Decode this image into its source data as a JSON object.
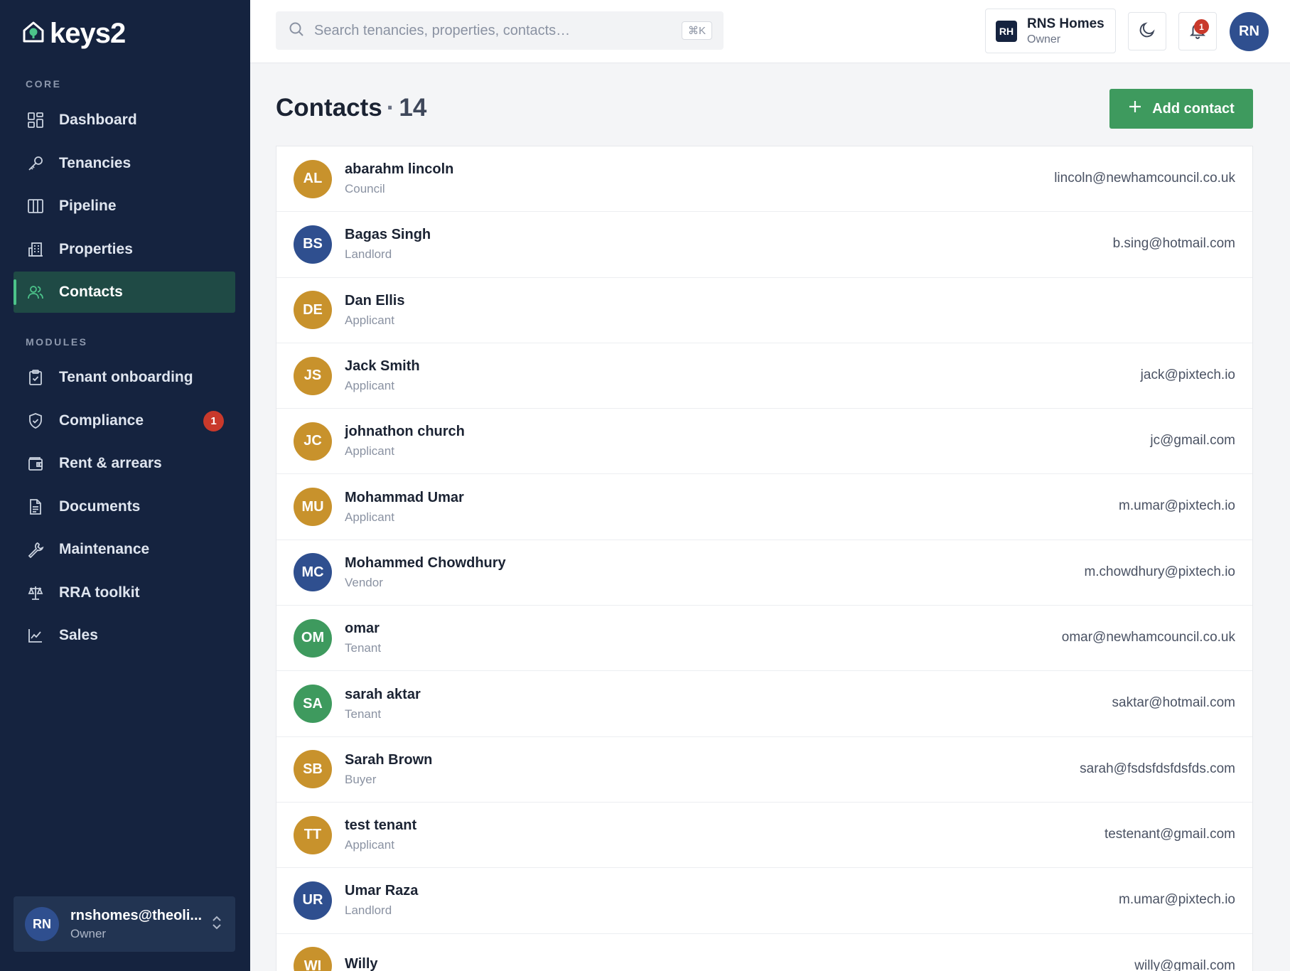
{
  "brand": {
    "name": "keys2"
  },
  "sidebar": {
    "core_label": "CORE",
    "modules_label": "MODULES",
    "core_items": [
      {
        "label": "Dashboard",
        "icon": "dashboard-icon"
      },
      {
        "label": "Tenancies",
        "icon": "key-icon"
      },
      {
        "label": "Pipeline",
        "icon": "columns-icon"
      },
      {
        "label": "Properties",
        "icon": "building-icon"
      },
      {
        "label": "Contacts",
        "icon": "users-icon",
        "active": true
      }
    ],
    "module_items": [
      {
        "label": "Tenant onboarding",
        "icon": "clipboard-check-icon"
      },
      {
        "label": "Compliance",
        "icon": "shield-icon",
        "badge": "1"
      },
      {
        "label": "Rent & arrears",
        "icon": "wallet-icon"
      },
      {
        "label": "Documents",
        "icon": "document-icon"
      },
      {
        "label": "Maintenance",
        "icon": "wrench-icon"
      },
      {
        "label": "RRA toolkit",
        "icon": "scales-icon"
      },
      {
        "label": "Sales",
        "icon": "chart-line-icon"
      }
    ],
    "user": {
      "initials": "RN",
      "email": "rnshomes@theoli...",
      "role": "Owner"
    }
  },
  "topbar": {
    "search_placeholder": "Search tenancies, properties, contacts…",
    "search_shortcut": "⌘K",
    "org": {
      "initials": "RH",
      "name": "RNS Homes",
      "role": "Owner"
    },
    "notifications_count": "1",
    "avatar_initials": "RN"
  },
  "page": {
    "title": "Contacts",
    "separator": "·",
    "count": "14",
    "add_button_label": "Add contact"
  },
  "colors": {
    "gold": "#c8922c",
    "blue": "#2f4f8f",
    "green": "#3e9a5e",
    "accent": "#4cc38a"
  },
  "contacts": [
    {
      "initials": "AL",
      "name": "abarahm lincoln",
      "role": "Council",
      "email": "lincoln@newhamcouncil.co.uk",
      "color": "#c8922c"
    },
    {
      "initials": "BS",
      "name": "Bagas Singh",
      "role": "Landlord",
      "email": "b.sing@hotmail.com",
      "color": "#2f4f8f"
    },
    {
      "initials": "DE",
      "name": "Dan Ellis",
      "role": "Applicant",
      "email": "",
      "color": "#c8922c"
    },
    {
      "initials": "JS",
      "name": "Jack Smith",
      "role": "Applicant",
      "email": "jack@pixtech.io",
      "color": "#c8922c"
    },
    {
      "initials": "JC",
      "name": "johnathon church",
      "role": "Applicant",
      "email": "jc@gmail.com",
      "color": "#c8922c"
    },
    {
      "initials": "MU",
      "name": "Mohammad Umar",
      "role": "Applicant",
      "email": "m.umar@pixtech.io",
      "color": "#c8922c"
    },
    {
      "initials": "MC",
      "name": "Mohammed Chowdhury",
      "role": "Vendor",
      "email": "m.chowdhury@pixtech.io",
      "color": "#2f4f8f"
    },
    {
      "initials": "OM",
      "name": "omar",
      "role": "Tenant",
      "email": "omar@newhamcouncil.co.uk",
      "color": "#3e9a5e"
    },
    {
      "initials": "SA",
      "name": "sarah aktar",
      "role": "Tenant",
      "email": "saktar@hotmail.com",
      "color": "#3e9a5e"
    },
    {
      "initials": "SB",
      "name": "Sarah Brown",
      "role": "Buyer",
      "email": "sarah@fsdsfdsfdsfds.com",
      "color": "#c8922c"
    },
    {
      "initials": "TT",
      "name": "test tenant",
      "role": "Applicant",
      "email": "testenant@gmail.com",
      "color": "#c8922c"
    },
    {
      "initials": "UR",
      "name": "Umar Raza",
      "role": "Landlord",
      "email": "m.umar@pixtech.io",
      "color": "#2f4f8f"
    },
    {
      "initials": "WI",
      "name": "Willy",
      "role": "",
      "email": "willy@gmail.com",
      "color": "#c8922c"
    }
  ]
}
